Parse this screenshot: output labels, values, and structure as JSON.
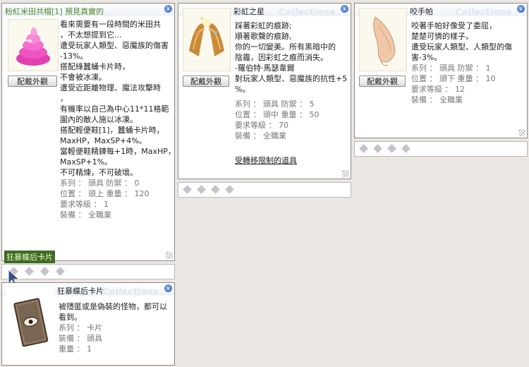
{
  "win1": {
    "title": "粉紅米田共帽[1] 預見真實的",
    "button": "配戴外觀",
    "lines": [
      "看來需要有一段時間的米田共",
      "，不太想提到它...",
      "遭受玩家人類型、惡魔族的傷害",
      "-13%。",
      "搭配綠蠶蛹卡片時，",
      "不會被冰凍。",
      "遭受近距離物理、魔法攻擊時",
      "，",
      "有機率以自己為中心11*11格範",
      "圍內的敵人施以冰凍。",
      "搭配輕便鞋[1]，蠶蛹卡片時，",
      "MaxHP，MaxSP+4%。",
      "當輕便鞋精鍊每+1時，MaxHP，",
      "MaxSP+1%。",
      "不可精煉，不可破壞。"
    ],
    "stats": [
      [
        "系列 ： 頭具 防禦 ： 0"
      ],
      [
        "位置 ： 頭上 重量 ： 120"
      ],
      [
        "要求等級 ： 1"
      ],
      [
        "裝備 ： 全職業"
      ]
    ]
  },
  "win2": {
    "title": "彩虹之星",
    "watermark": "Collections",
    "button": "配戴外觀",
    "lines": [
      "踩著彩虹的痕跡;",
      "順著歌聲的痕跡,",
      "你的一切變美。所有黑暗中的",
      "陰霾，因彩虹之痕而消失。",
      "-羅伯特·馬瑟韋爾",
      "對玩家人類型、惡魔族的抗性+5",
      "%。"
    ],
    "stats": [
      "系列 ： 頭具 防禦 ： 5",
      "位置 ： 頭中 重量 ： 50",
      "要求等級 ： 70",
      "裝備 ： 全職業"
    ],
    "footer": "受轉移限制的道具"
  },
  "win3": {
    "title": "咬手帕",
    "watermark": "Collections",
    "button": "配戴外觀",
    "lines": [
      "咬著手帕好像受了委屈，",
      "楚楚可憐的樣子。",
      "遭受玩家人類型、人類型的傷",
      "害-3%。"
    ],
    "stats": [
      "系列 ： 頭具 防禦 ： 1",
      "位置 ： 頭下 重量 ： 10",
      "要求等級 ： 12",
      "裝備 ： 全職業"
    ]
  },
  "win4": {
    "title": "狂暴蝶后卡片",
    "watermark": "Collections",
    "lines": [
      "被隱匿或是偽裝的怪物，都可以",
      "看到。"
    ],
    "stats": [
      "系列 ： 卡片",
      "裝備 ： 頭具",
      "重量 ： 1"
    ]
  },
  "tag": "狂暴蝶后卡片",
  "close_glyph": "x"
}
